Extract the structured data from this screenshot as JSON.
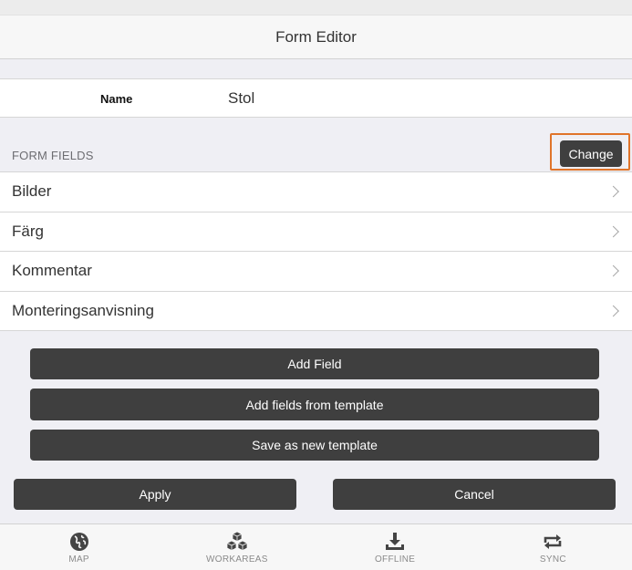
{
  "header": {
    "title": "Form Editor"
  },
  "name_row": {
    "label": "Name",
    "value": "Stol"
  },
  "form_fields": {
    "section_label": "FORM FIELDS",
    "change_label": "Change",
    "items": [
      {
        "label": "Bilder"
      },
      {
        "label": "Färg"
      },
      {
        "label": "Kommentar"
      },
      {
        "label": "Monteringsanvisning"
      }
    ]
  },
  "actions": {
    "add_field": "Add Field",
    "add_from_template": "Add fields from template",
    "save_template": "Save as new template",
    "apply": "Apply",
    "cancel": "Cancel"
  },
  "tabs": [
    {
      "label": "MAP",
      "icon": "globe-icon"
    },
    {
      "label": "WORKAREAS",
      "icon": "boxes-icon"
    },
    {
      "label": "OFFLINE",
      "icon": "download-icon"
    },
    {
      "label": "SYNC",
      "icon": "sync-icon"
    }
  ],
  "colors": {
    "button_bg": "#3f3f3f",
    "highlight": "#e0742a",
    "background": "#efeff4"
  }
}
